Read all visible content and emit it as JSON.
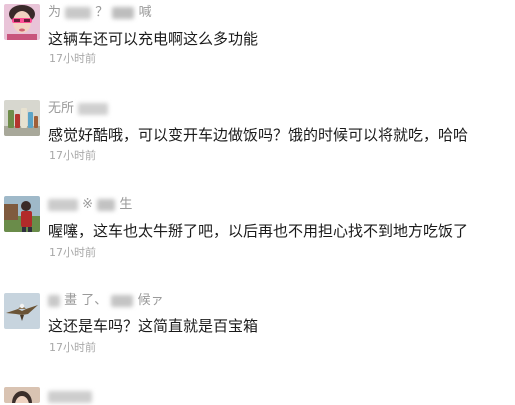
{
  "comments": [
    {
      "name_visible": "为",
      "name_mid": "？",
      "name_tail": "喊",
      "text": "这辆车还可以充电啊这么多功能",
      "time": "17小时前",
      "avatar": "woman-pink-portrait"
    },
    {
      "name_visible": "无所",
      "name_mid": "",
      "name_tail": "",
      "text": "感觉好酷哦，可以变开车边做饭吗？饿的时候可以将就吃，哈哈",
      "time": "17小时前",
      "avatar": "bottles-still-life"
    },
    {
      "name_visible": "",
      "name_mid": "※",
      "name_tail": "生",
      "text": "喔噻，这车也太牛掰了吧，以后再也不用担心找不到地方吃饭了",
      "time": "17小时前",
      "avatar": "person-outdoors"
    },
    {
      "name_visible": "畫",
      "name_mid": "了、",
      "name_tail": "候ァ",
      "text": "这还是车吗？这简直就是百宝箱",
      "time": "17小时前",
      "avatar": "eagle-flying"
    },
    {
      "name_visible": "",
      "name_mid": "",
      "name_tail": "",
      "text": "",
      "time": "",
      "avatar": "portrait-partial"
    }
  ]
}
